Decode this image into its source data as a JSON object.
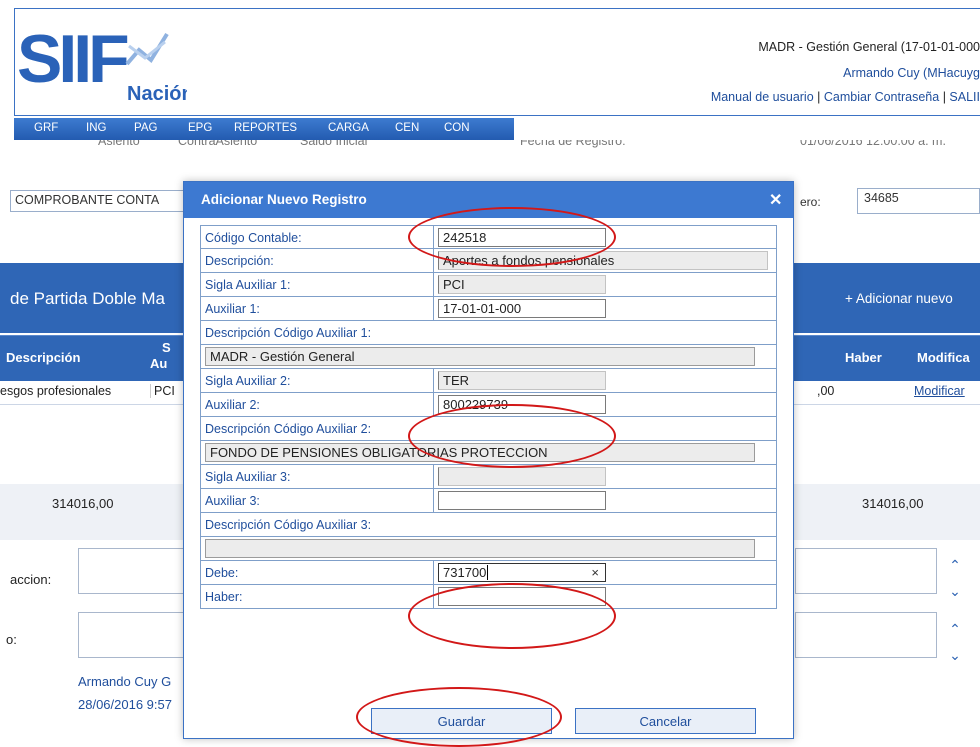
{
  "header": {
    "logo_text": "SIIF",
    "logo_sub": "Nación",
    "org": "MADR - Gestión General (17-01-01-000",
    "user": "Armando Cuy (MHacuyg",
    "links": [
      "Manual de usuario",
      "Cambiar Contraseña",
      "SALII"
    ],
    "separator": " | ",
    "menu": [
      "GRF",
      "ING",
      "PAG",
      "EPG",
      "REPORTES",
      "CARGA",
      "CEN",
      "CON"
    ]
  },
  "background": {
    "cut_line": [
      "Asiento",
      "ContraAsiento",
      "Saldo Inicial",
      "Fecha de Registro:",
      "01/06/2016 12:00:00 a. m."
    ],
    "comprobante": "COMPROBANTE CONTA",
    "numero_label": "ero:",
    "numero_value": "34685",
    "band_title": "de Partida Doble Ma",
    "add_new": "+ Adicionar nuevo",
    "columns": {
      "descripcion": "Descripción",
      "aux_stub": "Au",
      "aux_stub_top": "S",
      "haber": "Haber",
      "modificar": "Modifica"
    },
    "row": {
      "descripcion": "esgos profesionales",
      "sigla": "PCI",
      "haber": ",00",
      "modificar": "Modificar"
    },
    "total_left": "314016,00",
    "total_right": "314016,00",
    "memo1_label": "accion:",
    "memo2_label": "o:",
    "footer_user": "Armando Cuy G",
    "footer_date": "28/06/2016 9:57"
  },
  "modal": {
    "title": "Adicionar Nuevo Registro",
    "close": "✕",
    "fields": {
      "codigo_contable": {
        "label": "Código Contable:",
        "value": "242518"
      },
      "descripcion": {
        "label": "Descripción:",
        "value": "Aportes a fondos  pensionales"
      },
      "sigla_aux1": {
        "label": "Sigla Auxiliar 1:",
        "value": "PCI"
      },
      "auxiliar1": {
        "label": "Auxiliar 1:",
        "value": "17-01-01-000"
      },
      "desc_aux1": {
        "label": "Descripción Código Auxiliar 1:",
        "value": "MADR - Gestión General"
      },
      "sigla_aux2": {
        "label": "Sigla Auxiliar 2:",
        "value": "TER"
      },
      "auxiliar2": {
        "label": "Auxiliar 2:",
        "value": "800229739"
      },
      "desc_aux2": {
        "label": "Descripción Código Auxiliar 2:",
        "value": "FONDO DE PENSIONES OBLIGATORIAS PROTECCION"
      },
      "sigla_aux3": {
        "label": "Sigla Auxiliar 3:",
        "value": ""
      },
      "auxiliar3": {
        "label": "Auxiliar 3:",
        "value": ""
      },
      "desc_aux3": {
        "label": "Descripción Código Auxiliar 3:",
        "value": ""
      },
      "debe": {
        "label": "Debe:",
        "value": "731700"
      },
      "haber": {
        "label": "Haber:",
        "value": ""
      }
    },
    "clear_glyph": "×",
    "save": "Guardar",
    "cancel": "Cancelar"
  },
  "colors": {
    "header_blue": "#2f66b6",
    "modal_head": "#3d79d1",
    "annotation_red": "#d21818"
  }
}
